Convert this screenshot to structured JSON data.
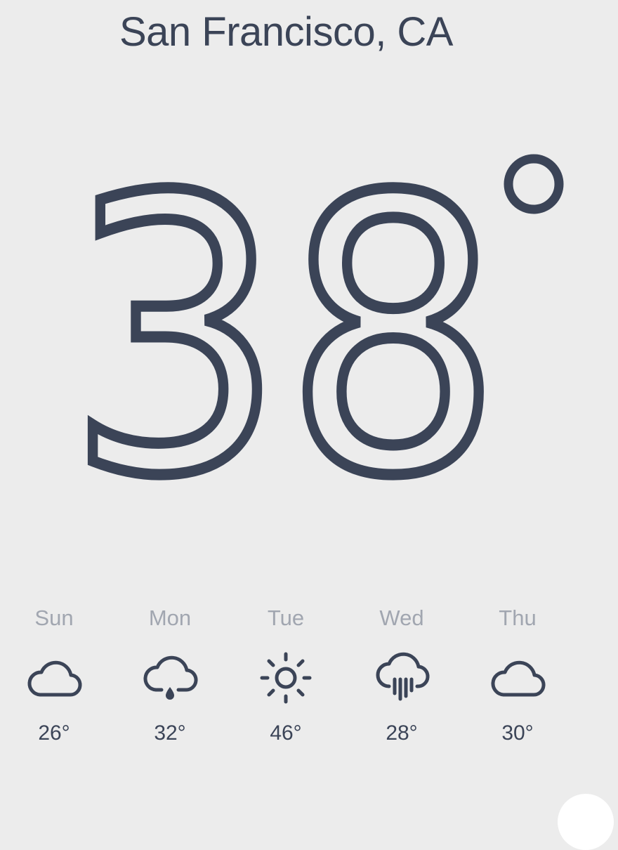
{
  "location": {
    "city": "San Francisco, CA"
  },
  "current": {
    "temperature": "38",
    "unit_symbol": "°"
  },
  "forecast": [
    {
      "day": "Sun",
      "icon": "cloud-icon",
      "temp": "26°"
    },
    {
      "day": "Mon",
      "icon": "cloud-drizzle-icon",
      "temp": "32°"
    },
    {
      "day": "Tue",
      "icon": "sun-icon",
      "temp": "46°"
    },
    {
      "day": "Wed",
      "icon": "cloud-rain-icon",
      "temp": "28°"
    },
    {
      "day": "Thu",
      "icon": "cloud-icon",
      "temp": "30°"
    }
  ],
  "colors": {
    "background": "#ececec",
    "primary_text": "#3b4457",
    "secondary_text": "#a1a6b0"
  }
}
